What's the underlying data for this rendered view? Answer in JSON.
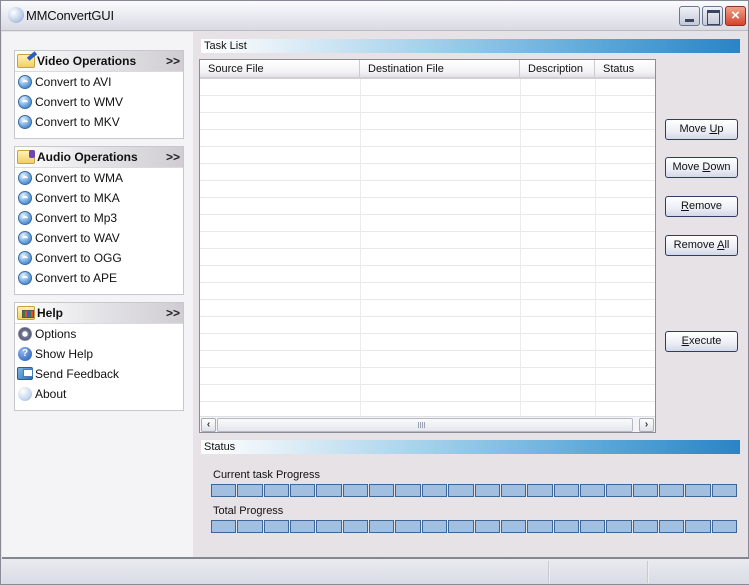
{
  "window": {
    "title": "MMConvertGUI",
    "controls": {
      "minimize": "minimize",
      "maximize": "maximize",
      "close": "×"
    }
  },
  "sidebar": {
    "panels": [
      {
        "title": "Video Operations",
        "chevron": ">>",
        "icon": "folder-pen-icon",
        "items": [
          {
            "label": "Convert to AVI",
            "icon": "disc-icon"
          },
          {
            "label": "Convert to WMV",
            "icon": "disc-icon"
          },
          {
            "label": "Convert to MKV",
            "icon": "disc-icon"
          }
        ]
      },
      {
        "title": "Audio Operations",
        "chevron": ">>",
        "icon": "folder-note-icon",
        "items": [
          {
            "label": "Convert to WMA",
            "icon": "disc-icon"
          },
          {
            "label": "Convert to MKA",
            "icon": "disc-icon"
          },
          {
            "label": "Convert to Mp3",
            "icon": "disc-icon"
          },
          {
            "label": "Convert to WAV",
            "icon": "disc-icon"
          },
          {
            "label": "Convert to OGG",
            "icon": "disc-icon"
          },
          {
            "label": "Convert to APE",
            "icon": "disc-icon"
          }
        ]
      },
      {
        "title": "Help",
        "chevron": ">>",
        "icon": "folder-calendar-icon",
        "items": [
          {
            "label": "Options",
            "icon": "gear-icon"
          },
          {
            "label": "Show Help",
            "icon": "help-icon"
          },
          {
            "label": "Send Feedback",
            "icon": "feedback-icon"
          },
          {
            "label": "About",
            "icon": "about-icon"
          }
        ]
      }
    ]
  },
  "task_list": {
    "title": "Task List",
    "columns": [
      "Source File",
      "Destination File",
      "Description",
      "Status"
    ],
    "rows": []
  },
  "buttons": {
    "move_up": {
      "pre": "Move ",
      "mnemonic": "U",
      "post": "p"
    },
    "move_down": {
      "pre": "Move ",
      "mnemonic": "D",
      "post": "own"
    },
    "remove": {
      "pre": "",
      "mnemonic": "R",
      "post": "emove"
    },
    "remove_all": {
      "pre": "Remove ",
      "mnemonic": "A",
      "post": "ll"
    },
    "execute": {
      "pre": "",
      "mnemonic": "E",
      "post": "xecute"
    }
  },
  "status": {
    "title": "Status",
    "current_task_label": "Current task Progress",
    "current_task_progress": 100,
    "total_label": "Total Progress",
    "total_progress": 100
  },
  "colors": {
    "progress_fill": "#a3bfe0",
    "progress_border": "#3e6698",
    "section_bar_accent": "#2a84c6"
  }
}
